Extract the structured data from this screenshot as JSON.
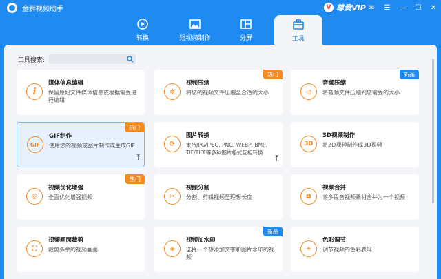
{
  "window": {
    "app_title": "金狮视频助手",
    "vip_badge": "V",
    "vip_label": "尊贵VIP",
    "controls": {
      "mail": "✉",
      "menu": "☰",
      "minimize": "—",
      "maximize": "☐",
      "close": "✕"
    }
  },
  "tabs": [
    {
      "label": "转换",
      "icon": "convert-icon",
      "active": false
    },
    {
      "label": "短视频制作",
      "icon": "image-icon",
      "active": false
    },
    {
      "label": "分屏",
      "icon": "split-screen-icon",
      "active": false
    },
    {
      "label": "工具",
      "icon": "toolbox-icon",
      "active": true
    }
  ],
  "search": {
    "label": "工具搜索:",
    "value": "",
    "placeholder": ""
  },
  "cards": [
    {
      "title": "媒体信息编辑",
      "desc": "保留原始文件媒体信息或根据需要进行编辑",
      "icon": "info-icon",
      "glyph": "i",
      "badge": ""
    },
    {
      "title": "视频压缩",
      "desc": "将您的视频文件压缩至合适的大小",
      "icon": "compress-icon",
      "glyph": "≑",
      "badge": "热门"
    },
    {
      "title": "音频压缩",
      "desc": "将音频文件压缩到您需要的大小",
      "icon": "audio-compress-icon",
      "glyph": "◁)",
      "badge": "新品"
    },
    {
      "title": "GIF制作",
      "desc": "使用您的视频或图片制作或生成GIF",
      "icon": "gif-icon",
      "glyph": "GIF",
      "badge": "热门",
      "pin": "⤒"
    },
    {
      "title": "图片转换",
      "desc": "支持JPG/JPEG, PNG, WEBP, BMP, TIF/TIFF等多种图片格式互相转换",
      "icon": "image-convert-icon",
      "glyph": "⟳",
      "badge": "",
      "pin": "⤒"
    },
    {
      "title": "3D视频制作",
      "desc": "将2D视频制作成3D视频",
      "icon": "3d-icon",
      "glyph": "3D",
      "badge": ""
    },
    {
      "title": "视频优化增强",
      "desc": "全面优化增强视频",
      "icon": "palette-icon",
      "glyph": "◎",
      "badge": "热门"
    },
    {
      "title": "视频分割",
      "desc": "分割、剪辑视频至理想长度",
      "icon": "scissors-icon",
      "glyph": "✂",
      "badge": ""
    },
    {
      "title": "视频合并",
      "desc": "将多段音视频素材合并为一个视频",
      "icon": "merge-icon",
      "glyph": "⧉",
      "badge": ""
    },
    {
      "title": "视频画面裁剪",
      "desc": "裁剪多余的视频画面",
      "icon": "crop-icon",
      "glyph": "⛶",
      "badge": ""
    },
    {
      "title": "视频加水印",
      "desc": "选择一个想添加文字和图片水印的视频",
      "icon": "watermark-icon",
      "glyph": "◈",
      "badge": "新品"
    },
    {
      "title": "色彩调节",
      "desc": "调节视频的色彩表现",
      "icon": "sun-icon",
      "glyph": "☀",
      "badge": ""
    }
  ]
}
